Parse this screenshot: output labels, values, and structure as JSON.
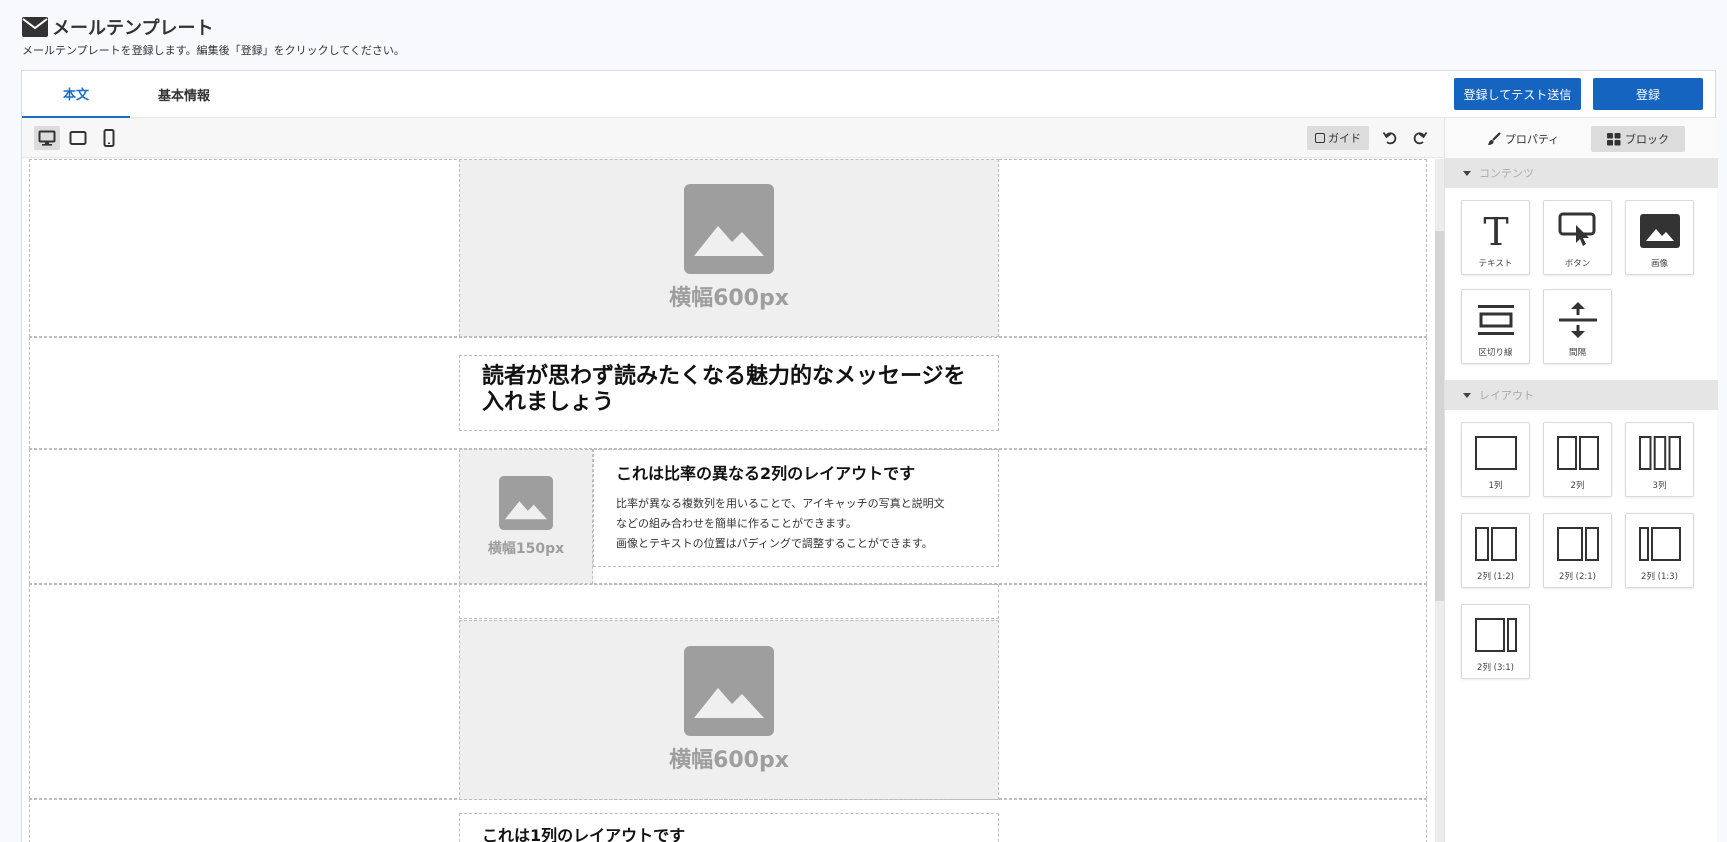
{
  "header": {
    "title": "メールテンプレート",
    "description": "メールテンプレートを登録します。編集後「登録」をクリックしてください。"
  },
  "tabs": [
    {
      "label": "本文",
      "active": true
    },
    {
      "label": "基本情報",
      "active": false
    }
  ],
  "actions": {
    "test_send_label": "登録してテスト送信",
    "register_label": "登録"
  },
  "toolbar": {
    "guide_label": "ガイド",
    "device_icons": [
      "desktop-icon",
      "tablet-icon",
      "mobile-icon"
    ]
  },
  "canvas": {
    "hero_image_label": "横幅600px",
    "headline": "読者が思わず読みたくなる魅力的なメッセージを入れましょう",
    "two_col": {
      "image_label": "横幅150px",
      "heading": "これは比率の異なる2列のレイアウトです",
      "body_lines": [
        "比率が異なる複数列を用いることで、アイキャッチの写真と説明文",
        "などの組み合わせを簡単に作ることができます。",
        "画像とテキストの位置はパディングで調整することができます。"
      ]
    },
    "second_image_label": "横幅600px",
    "one_col_heading": "これは1列のレイアウトです"
  },
  "sidebar": {
    "tabs": [
      {
        "label": "プロパティ",
        "icon": "brush-icon",
        "active": false
      },
      {
        "label": "ブロック",
        "icon": "blocks-icon",
        "active": true
      }
    ],
    "contents_title": "コンテンツ",
    "contents": [
      {
        "label": "テキスト",
        "icon": "text-icon"
      },
      {
        "label": "ボタン",
        "icon": "button-icon"
      },
      {
        "label": "画像",
        "icon": "image-icon"
      },
      {
        "label": "区切り線",
        "icon": "divider-icon"
      },
      {
        "label": "間隔",
        "icon": "spacer-icon"
      }
    ],
    "layout_title": "レイアウト",
    "layouts": [
      {
        "label": "1列",
        "icon": "layout-1col-icon"
      },
      {
        "label": "2列",
        "icon": "layout-2col-icon"
      },
      {
        "label": "3列",
        "icon": "layout-3col-icon"
      },
      {
        "label": "2列 (1:2)",
        "icon": "layout-1-2-icon"
      },
      {
        "label": "2列 (2:1)",
        "icon": "layout-2-1-icon"
      },
      {
        "label": "2列 (1:3)",
        "icon": "layout-1-3-icon"
      },
      {
        "label": "2列 (3:1)",
        "icon": "layout-3-1-icon"
      }
    ]
  },
  "colors": {
    "accent": "#1565c0",
    "placeholder_bg": "#efefef",
    "placeholder_fg": "#9e9e9e"
  }
}
